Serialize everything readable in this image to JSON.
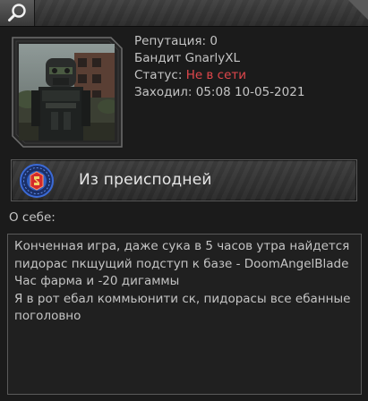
{
  "toolbar": {
    "search_icon": "search-icon"
  },
  "profile": {
    "reputation": "Репутация: 0",
    "name_line": "Бандит GnarlyXL",
    "status_label": "Статус:",
    "status_value": "Не в сети",
    "last_seen": "Заходил: 05:08 10-05-2021",
    "status_color": "#e0474c"
  },
  "rank": {
    "label": "Из преисподней",
    "badge_icon": "rank-emblem-icon",
    "badge_color": "#2f5fc4",
    "badge_inner_color": "#d42a2a"
  },
  "about": {
    "label": "О себе:",
    "text": "Конченная игра, даже сука в 5 часов утра найдется\nпидорас пкщущий подступ к базе - DoomAngelBlade\nЧас фарма и -20 дигаммы\nЯ в рот ебал коммьюнити ск, пидорасы все ебанные\nпоголовно"
  }
}
